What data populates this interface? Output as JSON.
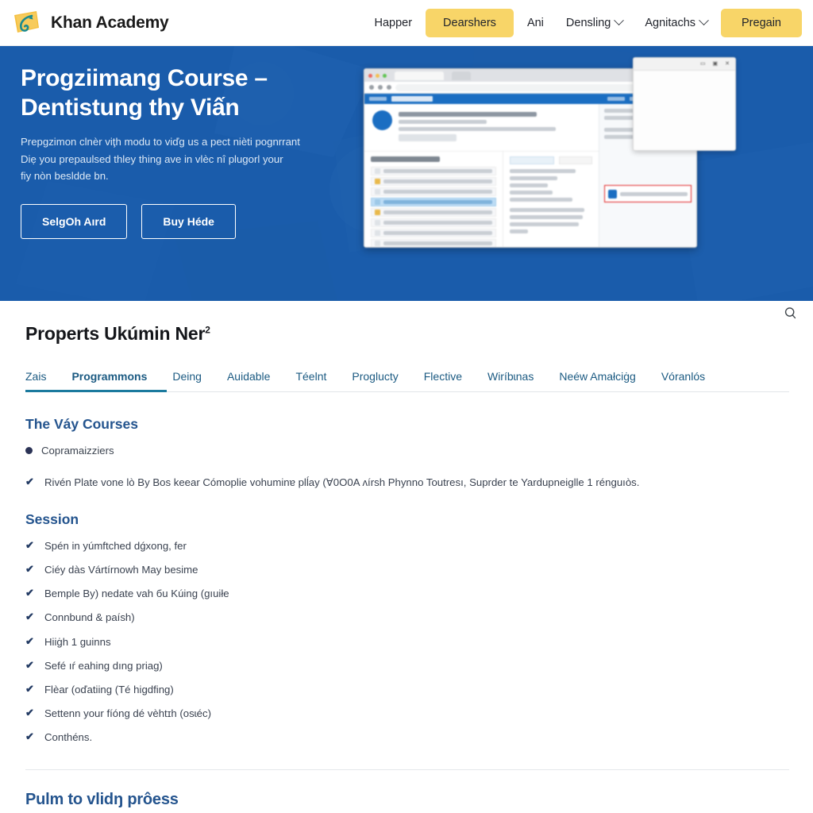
{
  "header": {
    "logo_icon": "khan-academy-leaf-logo",
    "brand": "Khan Academy",
    "nav": [
      {
        "label": "Happer",
        "type": "link",
        "caret": false
      },
      {
        "label": "Dearshers",
        "type": "pill",
        "caret": false
      },
      {
        "label": "Ani",
        "type": "link",
        "caret": false
      },
      {
        "label": "Densling",
        "type": "link",
        "caret": true
      },
      {
        "label": "Agnitachs",
        "type": "link",
        "caret": true
      },
      {
        "label": "Pregain",
        "type": "pill",
        "caret": false
      }
    ],
    "pill_color": "#f8d568"
  },
  "hero": {
    "bg_color": "#1a5cab",
    "title": "Progziimang Course –\nDentistung thy Viấn",
    "subtitle": "Prepgzimon clnèr viţh modu to viďg us a pect nièti pognrrant\nDiẹ you prepaulsed thley thing ave in vlèc nî plugorl your\nfiy nòn besldde bn.",
    "buttons": [
      {
        "label": "SelgOh Aırd"
      },
      {
        "label": "Buy Héde"
      }
    ],
    "mock_image": "blurred-browser-screenshot"
  },
  "main": {
    "page_title": "Properts Ukúmin Ner",
    "page_title_sup": "2",
    "search_icon": "search-icon",
    "tabs": [
      {
        "label": "Zais",
        "active": false
      },
      {
        "label": "Programmons",
        "active": true
      },
      {
        "label": "Deing",
        "active": false
      },
      {
        "label": "Auidable",
        "active": false
      },
      {
        "label": "Téelnt",
        "active": false
      },
      {
        "label": "Proglucty",
        "active": false
      },
      {
        "label": "Flective",
        "active": false
      },
      {
        "label": "Wiríbɩnas",
        "active": false
      },
      {
        "label": "Neéw Amałciġg",
        "active": false
      },
      {
        "label": "Vóranlós",
        "active": false
      }
    ],
    "section_one": {
      "title": "The Váy Courses",
      "bullet": "Copramaizziers",
      "check": "Rivén Plate vone lò By Bos keear Cómoplie vohuminɐ plĺay (ꓯ0O0A ʌírsh Phynno Toutresı, Suprder te Yardupneiglle 1 rénguıòs."
    },
    "section_two": {
      "title": "Session",
      "items": [
        "Spén in yúmftched dǵxong, fer",
        "Ciéy dàs Vártírnowh May besime",
        "Bemple By) nedate vah бu Kúing (gıuiłe",
        "Connbund & paísh)",
        "Hiiġh 1 guinns",
        "Sefé ıŕ eahing dıng priag)",
        "Flèar (oďatiing (Té higdfing)",
        "Settenn your fíóng dé vèhtɪh (osɩéc)",
        "Conthéns."
      ]
    },
    "bottom_title": "Pulm to vlidŋ prôess"
  }
}
